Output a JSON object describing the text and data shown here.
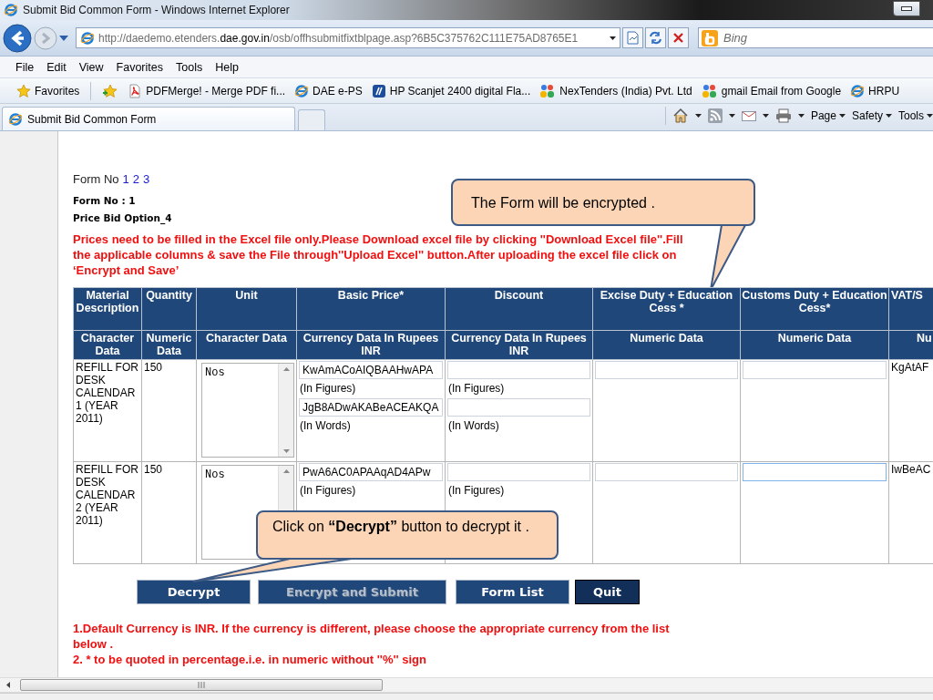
{
  "window": {
    "title": "Submit Bid Common Form - Windows Internet Explorer"
  },
  "address_bar": {
    "url": "http://daedemo.etenders.**dae.gov.in**/osb/offhsubmitfixtblpage.asp?6B5C375762C111E75AD8765E1",
    "search_placeholder": "Bing"
  },
  "menu": [
    "File",
    "Edit",
    "View",
    "Favorites",
    "Tools",
    "Help"
  ],
  "favorites_bar": {
    "label": "Favorites",
    "items": [
      {
        "label": "PDFMerge! - Merge PDF fi...",
        "kind": "pdf"
      },
      {
        "label": "DAE e-PS",
        "kind": "ie"
      },
      {
        "label": "HP Scanjet 2400 digital Fla...",
        "kind": "hp"
      },
      {
        "label": "NexTenders (India) Pvt. Ltd",
        "kind": "people"
      },
      {
        "label": "gmail Email from Google",
        "kind": "people"
      },
      {
        "label": "HRPU",
        "kind": "ie"
      }
    ]
  },
  "tabs": [
    {
      "label": "Submit Bid Common Form",
      "selected": true
    },
    {
      "selected": false
    }
  ],
  "command_bar": [
    "Page",
    "Safety",
    "Tools"
  ],
  "page": {
    "form_links_label": "Form No",
    "form_links": [
      "1",
      "2",
      "3"
    ],
    "form_no": "Form No : 1",
    "option": "Price Bid Option_4",
    "instructions": "Prices need to be filled in the Excel file only.Please Download excel file by clicking ''Download Excel file''.Fill the applicable columns & save the File through''Upload Excel'' button.After uploading the excel file click on ‘Encrypt and Save’",
    "table": {
      "columns": [
        {
          "title": "Material Description",
          "type": "Character Data"
        },
        {
          "title": "Quantity",
          "type": "Numeric Data"
        },
        {
          "title": "Unit",
          "type": "Character Data"
        },
        {
          "title": "Basic Price*",
          "type": "Currency Data In Rupees INR"
        },
        {
          "title": "Discount",
          "type": "Currency Data In Rupees INR"
        },
        {
          "title": "Excise Duty + Education Cess *",
          "type": "Numeric Data"
        },
        {
          "title": "Customs Duty + Education Cess*",
          "type": "Numeric Data"
        },
        {
          "title": "VAT/S",
          "type": "Nu"
        }
      ],
      "rows": [
        {
          "cells": [
            {
              "kind": "text",
              "text": "REFILL FOR DESK CALENDAR 1 (YEAR 2011)"
            },
            {
              "kind": "text",
              "text": "150"
            },
            {
              "kind": "textarea",
              "value": "Nos"
            },
            {
              "kind": "price",
              "lines": [
                {
                  "kind": "input",
                  "value": "KwAmACoAIQBAAHwAPA"
                },
                {
                  "kind": "label",
                  "text": "(In Figures)"
                },
                {
                  "kind": "input",
                  "value": "JgB8ADwAKABeACEAKQA"
                },
                {
                  "kind": "label",
                  "text": "(In Words)"
                }
              ]
            },
            {
              "kind": "price",
              "lines": [
                {
                  "kind": "input"
                },
                {
                  "kind": "label",
                  "text": "(In Figures)"
                },
                {
                  "kind": "input"
                },
                {
                  "kind": "label",
                  "text": "(In Words)"
                }
              ]
            },
            {
              "kind": "input",
              "focused": false
            },
            {
              "kind": "input",
              "focused": false
            },
            {
              "kind": "text",
              "text": "KgAtAF"
            }
          ]
        },
        {
          "cells": [
            {
              "kind": "text",
              "text": "REFILL FOR DESK CALENDAR 2 (YEAR 2011)"
            },
            {
              "kind": "text",
              "text": "150"
            },
            {
              "kind": "textarea",
              "value": "Nos"
            },
            {
              "kind": "price",
              "lines": [
                {
                  "kind": "input",
                  "value": "PwA6AC0APAAqAD4APw"
                },
                {
                  "kind": "label",
                  "text": "(In Figures)"
                }
              ]
            },
            {
              "kind": "price",
              "lines": [
                {
                  "kind": "input"
                },
                {
                  "kind": "label",
                  "text": "(In Figures)"
                }
              ]
            },
            {
              "kind": "input",
              "focused": false
            },
            {
              "kind": "input",
              "focused": true
            },
            {
              "kind": "text",
              "text": "IwBeAC"
            }
          ]
        }
      ]
    },
    "buttons": [
      {
        "label": "Decrypt",
        "disabled": false,
        "focused": false
      },
      {
        "label": "Encrypt and Submit",
        "disabled": true,
        "focused": false
      },
      {
        "label": "Form List",
        "disabled": false,
        "focused": false
      },
      {
        "label": "Quit",
        "disabled": false,
        "focused": true
      }
    ],
    "notes": [
      "1.Default Currency is INR. If the currency is different, please choose the appropriate currency from the list below .",
      "2. * to be quoted in percentage.i.e. in numeric without ''%'' sign"
    ]
  },
  "callouts": [
    {
      "text": "The Form will be encrypted ."
    },
    {
      "text": "Click on **“Decrypt”** button to decrypt it ."
    }
  ]
}
